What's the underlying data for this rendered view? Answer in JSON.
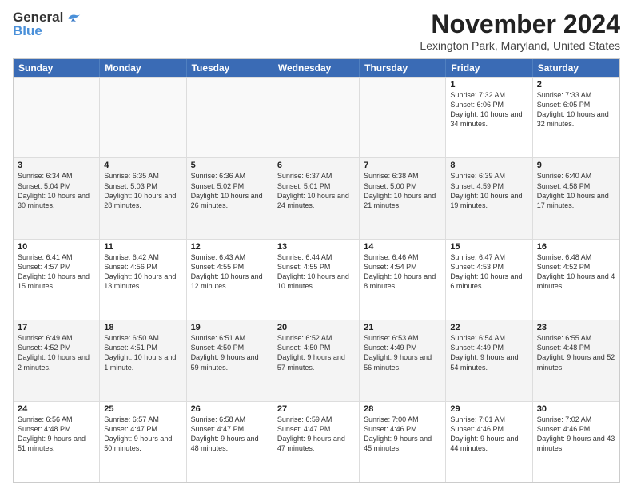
{
  "logo": {
    "line1": "General",
    "line2": "Blue"
  },
  "title": "November 2024",
  "location": "Lexington Park, Maryland, United States",
  "days_of_week": [
    "Sunday",
    "Monday",
    "Tuesday",
    "Wednesday",
    "Thursday",
    "Friday",
    "Saturday"
  ],
  "weeks": [
    [
      {
        "day": "",
        "info": ""
      },
      {
        "day": "",
        "info": ""
      },
      {
        "day": "",
        "info": ""
      },
      {
        "day": "",
        "info": ""
      },
      {
        "day": "",
        "info": ""
      },
      {
        "day": "1",
        "info": "Sunrise: 7:32 AM\nSunset: 6:06 PM\nDaylight: 10 hours\nand 34 minutes."
      },
      {
        "day": "2",
        "info": "Sunrise: 7:33 AM\nSunset: 6:05 PM\nDaylight: 10 hours\nand 32 minutes."
      }
    ],
    [
      {
        "day": "3",
        "info": "Sunrise: 6:34 AM\nSunset: 5:04 PM\nDaylight: 10 hours\nand 30 minutes."
      },
      {
        "day": "4",
        "info": "Sunrise: 6:35 AM\nSunset: 5:03 PM\nDaylight: 10 hours\nand 28 minutes."
      },
      {
        "day": "5",
        "info": "Sunrise: 6:36 AM\nSunset: 5:02 PM\nDaylight: 10 hours\nand 26 minutes."
      },
      {
        "day": "6",
        "info": "Sunrise: 6:37 AM\nSunset: 5:01 PM\nDaylight: 10 hours\nand 24 minutes."
      },
      {
        "day": "7",
        "info": "Sunrise: 6:38 AM\nSunset: 5:00 PM\nDaylight: 10 hours\nand 21 minutes."
      },
      {
        "day": "8",
        "info": "Sunrise: 6:39 AM\nSunset: 4:59 PM\nDaylight: 10 hours\nand 19 minutes."
      },
      {
        "day": "9",
        "info": "Sunrise: 6:40 AM\nSunset: 4:58 PM\nDaylight: 10 hours\nand 17 minutes."
      }
    ],
    [
      {
        "day": "10",
        "info": "Sunrise: 6:41 AM\nSunset: 4:57 PM\nDaylight: 10 hours\nand 15 minutes."
      },
      {
        "day": "11",
        "info": "Sunrise: 6:42 AM\nSunset: 4:56 PM\nDaylight: 10 hours\nand 13 minutes."
      },
      {
        "day": "12",
        "info": "Sunrise: 6:43 AM\nSunset: 4:55 PM\nDaylight: 10 hours\nand 12 minutes."
      },
      {
        "day": "13",
        "info": "Sunrise: 6:44 AM\nSunset: 4:55 PM\nDaylight: 10 hours\nand 10 minutes."
      },
      {
        "day": "14",
        "info": "Sunrise: 6:46 AM\nSunset: 4:54 PM\nDaylight: 10 hours\nand 8 minutes."
      },
      {
        "day": "15",
        "info": "Sunrise: 6:47 AM\nSunset: 4:53 PM\nDaylight: 10 hours\nand 6 minutes."
      },
      {
        "day": "16",
        "info": "Sunrise: 6:48 AM\nSunset: 4:52 PM\nDaylight: 10 hours\nand 4 minutes."
      }
    ],
    [
      {
        "day": "17",
        "info": "Sunrise: 6:49 AM\nSunset: 4:52 PM\nDaylight: 10 hours\nand 2 minutes."
      },
      {
        "day": "18",
        "info": "Sunrise: 6:50 AM\nSunset: 4:51 PM\nDaylight: 10 hours\nand 1 minute."
      },
      {
        "day": "19",
        "info": "Sunrise: 6:51 AM\nSunset: 4:50 PM\nDaylight: 9 hours\nand 59 minutes."
      },
      {
        "day": "20",
        "info": "Sunrise: 6:52 AM\nSunset: 4:50 PM\nDaylight: 9 hours\nand 57 minutes."
      },
      {
        "day": "21",
        "info": "Sunrise: 6:53 AM\nSunset: 4:49 PM\nDaylight: 9 hours\nand 56 minutes."
      },
      {
        "day": "22",
        "info": "Sunrise: 6:54 AM\nSunset: 4:49 PM\nDaylight: 9 hours\nand 54 minutes."
      },
      {
        "day": "23",
        "info": "Sunrise: 6:55 AM\nSunset: 4:48 PM\nDaylight: 9 hours\nand 52 minutes."
      }
    ],
    [
      {
        "day": "24",
        "info": "Sunrise: 6:56 AM\nSunset: 4:48 PM\nDaylight: 9 hours\nand 51 minutes."
      },
      {
        "day": "25",
        "info": "Sunrise: 6:57 AM\nSunset: 4:47 PM\nDaylight: 9 hours\nand 50 minutes."
      },
      {
        "day": "26",
        "info": "Sunrise: 6:58 AM\nSunset: 4:47 PM\nDaylight: 9 hours\nand 48 minutes."
      },
      {
        "day": "27",
        "info": "Sunrise: 6:59 AM\nSunset: 4:47 PM\nDaylight: 9 hours\nand 47 minutes."
      },
      {
        "day": "28",
        "info": "Sunrise: 7:00 AM\nSunset: 4:46 PM\nDaylight: 9 hours\nand 45 minutes."
      },
      {
        "day": "29",
        "info": "Sunrise: 7:01 AM\nSunset: 4:46 PM\nDaylight: 9 hours\nand 44 minutes."
      },
      {
        "day": "30",
        "info": "Sunrise: 7:02 AM\nSunset: 4:46 PM\nDaylight: 9 hours\nand 43 minutes."
      }
    ]
  ]
}
